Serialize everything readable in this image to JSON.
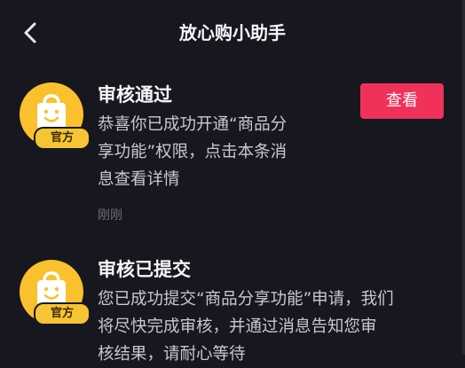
{
  "header": {
    "title": "放心购小助手",
    "back_icon": "chevron-left-icon"
  },
  "messages": [
    {
      "title": "审核通过",
      "body_lines": [
        "恭喜你已成功开通“商品分",
        "享功能”权限，点击本条消",
        "息查看详情"
      ],
      "time": "刚刚",
      "badge": "官方",
      "avatar_icon": "shopping-bag-smile-icon",
      "action_label": "查看"
    },
    {
      "title": "审核已提交",
      "body_lines": [
        "您已成功提交“商品分享功能”申请，我们",
        "将尽快完成审核，并通过消息告知您审",
        "核结果，请耐心等待"
      ],
      "badge": "官方",
      "avatar_icon": "shopping-bag-smile-icon"
    }
  ],
  "colors": {
    "background": "#17171f",
    "accent": "#f0325a",
    "avatar": "#fbc02d"
  }
}
